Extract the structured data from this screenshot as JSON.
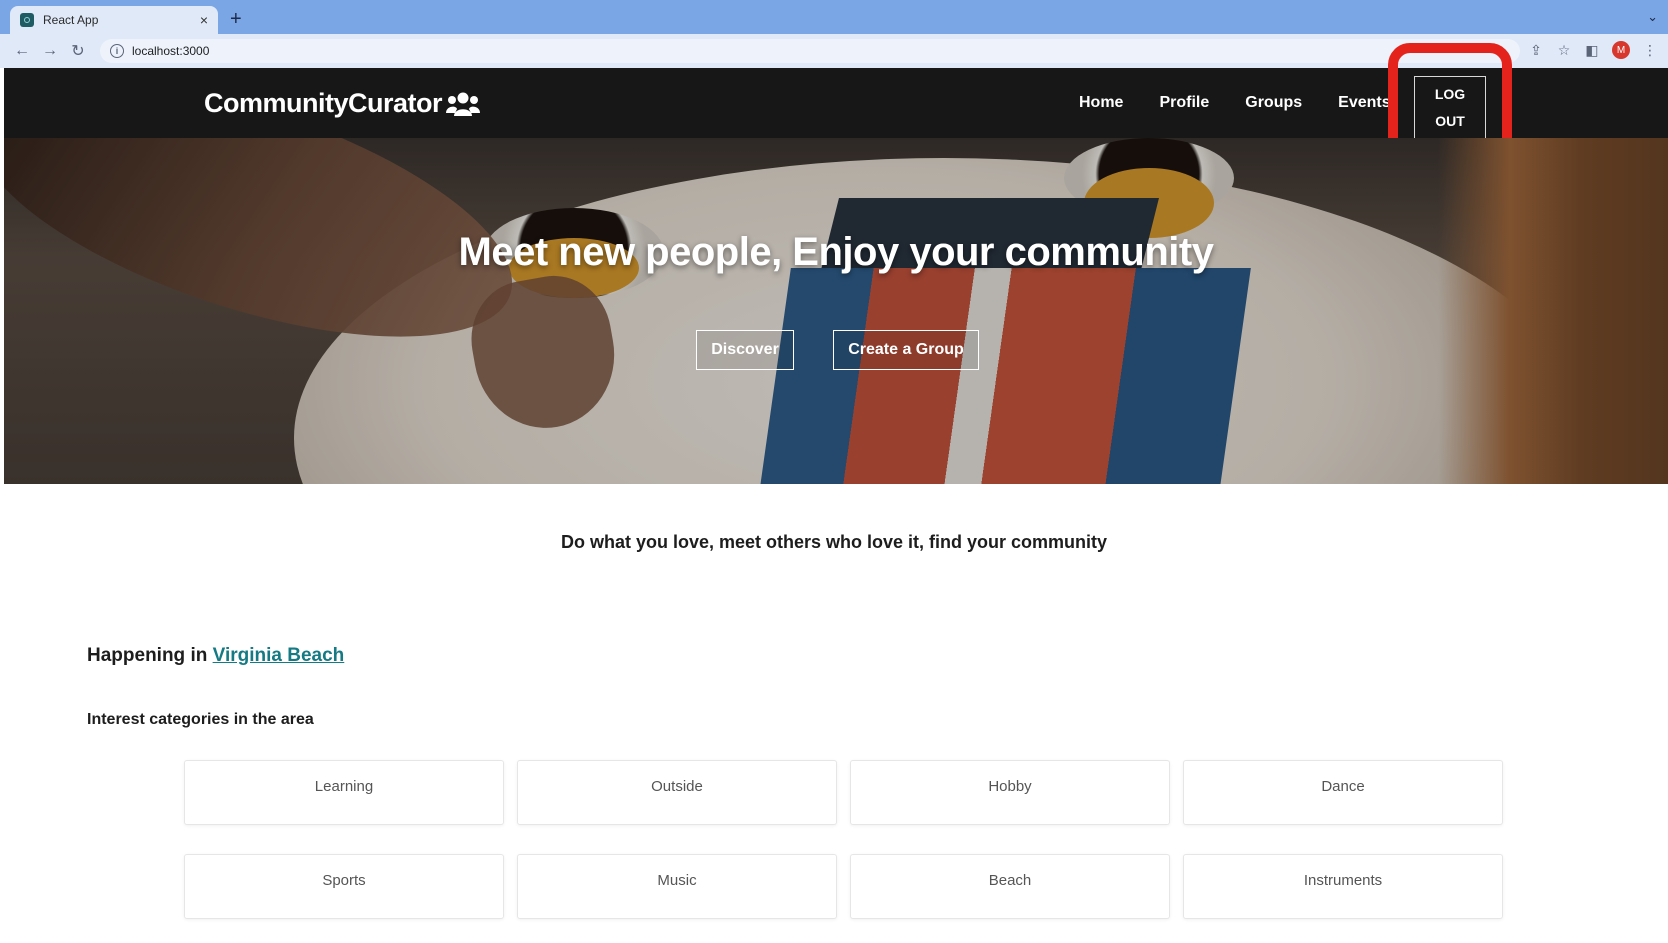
{
  "browser": {
    "tab_title": "React App",
    "tab_close": "×",
    "new_tab": "+",
    "url": "localhost:3000",
    "profile_initial": "M"
  },
  "header": {
    "brand": "CommunityCurator",
    "brand_icon": "users-icon",
    "nav": [
      "Home",
      "Profile",
      "Groups",
      "Events"
    ],
    "logout_line1": "LOG",
    "logout_line2": "OUT"
  },
  "hero": {
    "title": "Meet new people, Enjoy your community",
    "discover_label": "Discover",
    "create_group_label": "Create a Group"
  },
  "tagline": "Do what you love, meet others who love it, find your community",
  "happening": {
    "prefix": "Happening in",
    "city": "Virginia Beach"
  },
  "categories": {
    "heading": "Interest categories in the area",
    "items": [
      "Learning",
      "Outside",
      "Hobby",
      "Dance",
      "Sports",
      "Music",
      "Beach",
      "Instruments"
    ]
  },
  "colors": {
    "header_bg": "#171717",
    "link": "#157a84",
    "highlight": "#e4231d",
    "chrome_tabbar": "#7ba6e6"
  }
}
